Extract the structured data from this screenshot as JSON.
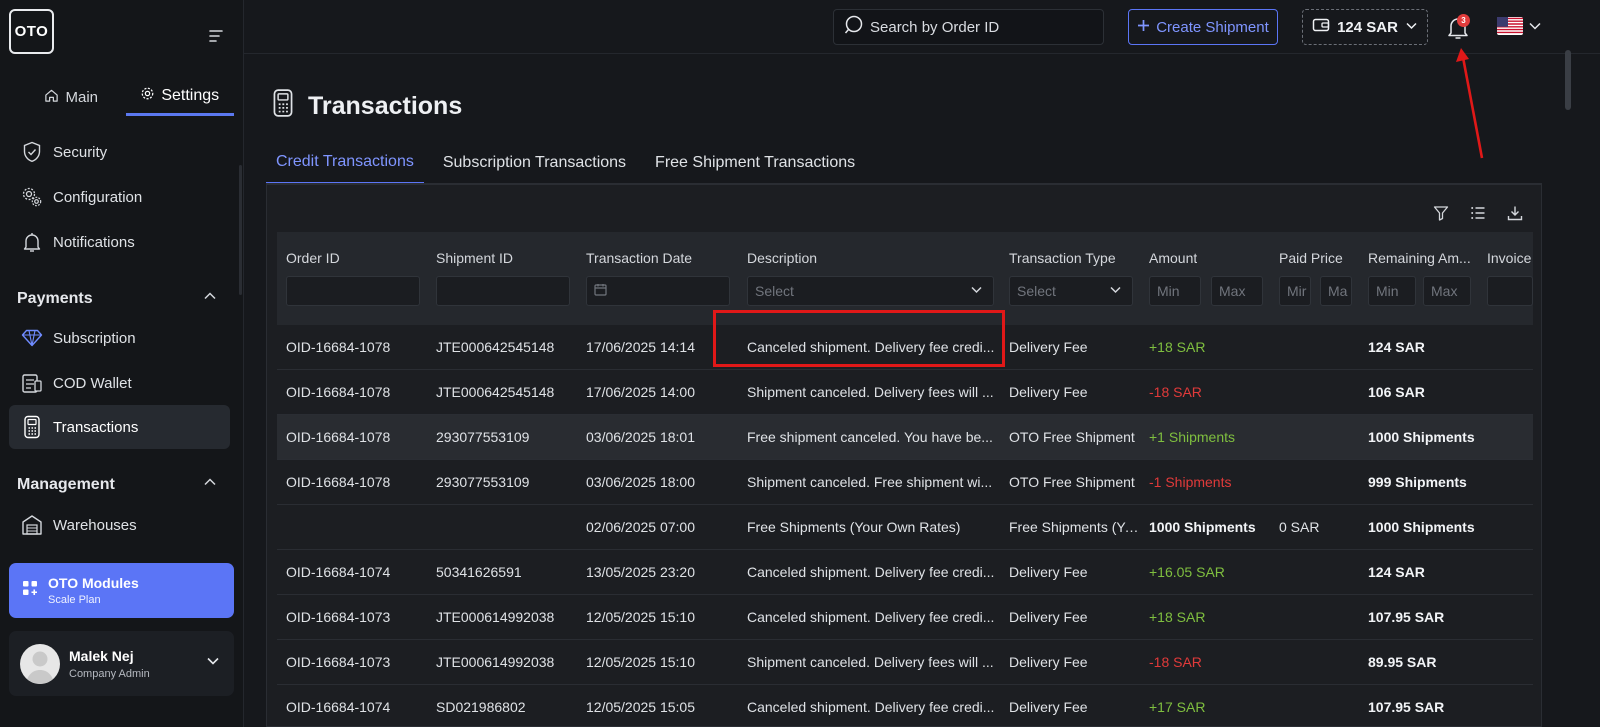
{
  "brand": {
    "logo_text": "OTO"
  },
  "sidebar": {
    "tabs": [
      {
        "label": "Main",
        "icon": "home-icon"
      },
      {
        "label": "Settings",
        "icon": "gear-icon"
      }
    ],
    "top_items": [
      {
        "label": "Security",
        "icon": "shield-icon"
      },
      {
        "label": "Configuration",
        "icon": "cogs-icon"
      },
      {
        "label": "Notifications",
        "icon": "bell-icon"
      }
    ],
    "payments": {
      "title": "Payments",
      "items": [
        {
          "label": "Subscription",
          "icon": "diamond-icon"
        },
        {
          "label": "COD Wallet",
          "icon": "wallet-icon"
        },
        {
          "label": "Transactions",
          "icon": "pos-terminal-icon"
        }
      ]
    },
    "management": {
      "title": "Management",
      "items": [
        {
          "label": "Warehouses",
          "icon": "warehouse-icon"
        }
      ]
    },
    "modules": {
      "title": "OTO Modules",
      "subtitle": "Scale Plan"
    },
    "user": {
      "name": "Malek Nej",
      "role": "Company Admin"
    }
  },
  "topbar": {
    "search_placeholder": "Search by Order ID",
    "create_label": "Create Shipment",
    "wallet_label": "124 SAR",
    "notification_count": "3"
  },
  "page": {
    "title": "Transactions",
    "tabs": [
      "Credit Transactions",
      "Subscription Transactions",
      "Free Shipment Transactions"
    ],
    "active_tab": 0
  },
  "table": {
    "columns": [
      "Order ID",
      "Shipment ID",
      "Transaction Date",
      "Description",
      "Transaction Type",
      "Amount",
      "Paid Price",
      "Remaining Am...",
      "Invoice"
    ],
    "filters": {
      "select_placeholder": "Select",
      "min_placeholder": "Min",
      "max_placeholder": "Max",
      "paid_min": "Mir",
      "paid_max": "Ma"
    },
    "rows": [
      {
        "order": "OID-16684-1078",
        "shipment": "JTE000642545148",
        "date": "17/06/2025 14:14",
        "desc": "Canceled shipment. Delivery fee credi...",
        "type": "Delivery Fee",
        "amount": "+18 SAR",
        "paid": "",
        "remaining": "124 SAR"
      },
      {
        "order": "OID-16684-1078",
        "shipment": "JTE000642545148",
        "date": "17/06/2025 14:00",
        "desc": "Shipment canceled. Delivery fees will ...",
        "type": "Delivery Fee",
        "amount": "-18 SAR",
        "paid": "",
        "remaining": "106 SAR"
      },
      {
        "order": "OID-16684-1078",
        "shipment": "293077553109",
        "date": "03/06/2025 18:01",
        "desc": "Free shipment canceled. You have be...",
        "type": "OTO Free Shipment",
        "amount": "+1 Shipments",
        "paid": "",
        "remaining": "1000 Shipments"
      },
      {
        "order": "OID-16684-1078",
        "shipment": "293077553109",
        "date": "03/06/2025 18:00",
        "desc": "Shipment canceled. Free shipment wi...",
        "type": "OTO Free Shipment",
        "amount": "-1 Shipments",
        "paid": "",
        "remaining": "999 Shipments"
      },
      {
        "order": "",
        "shipment": "",
        "date": "02/06/2025 07:00",
        "desc": "Free Shipments (Your Own Rates)",
        "type": "Free Shipments (Yo...",
        "amount": "1000 Shipments",
        "paid": "0 SAR",
        "remaining": "1000 Shipments"
      },
      {
        "order": "OID-16684-1074",
        "shipment": "50341626591",
        "date": "13/05/2025 23:20",
        "desc": "Canceled shipment. Delivery fee credi...",
        "type": "Delivery Fee",
        "amount": "+16.05 SAR",
        "paid": "",
        "remaining": "124 SAR"
      },
      {
        "order": "OID-16684-1073",
        "shipment": "JTE000614992038",
        "date": "12/05/2025 15:10",
        "desc": "Canceled shipment. Delivery fee credi...",
        "type": "Delivery Fee",
        "amount": "+18 SAR",
        "paid": "",
        "remaining": "107.95 SAR"
      },
      {
        "order": "OID-16684-1073",
        "shipment": "JTE000614992038",
        "date": "12/05/2025 15:10",
        "desc": "Shipment canceled. Delivery fees will ...",
        "type": "Delivery Fee",
        "amount": "-18 SAR",
        "paid": "",
        "remaining": "89.95 SAR"
      },
      {
        "order": "OID-16684-1074",
        "shipment": "SD021986802",
        "date": "12/05/2025 15:05",
        "desc": "Canceled shipment. Delivery fee credi...",
        "type": "Delivery Fee",
        "amount": "+17 SAR",
        "paid": "",
        "remaining": "107.95 SAR"
      }
    ]
  },
  "colors": {
    "accent": "#5b75f6",
    "positive": "#7fbf3f",
    "negative": "#e03a3a",
    "annotation": "#e01818"
  }
}
